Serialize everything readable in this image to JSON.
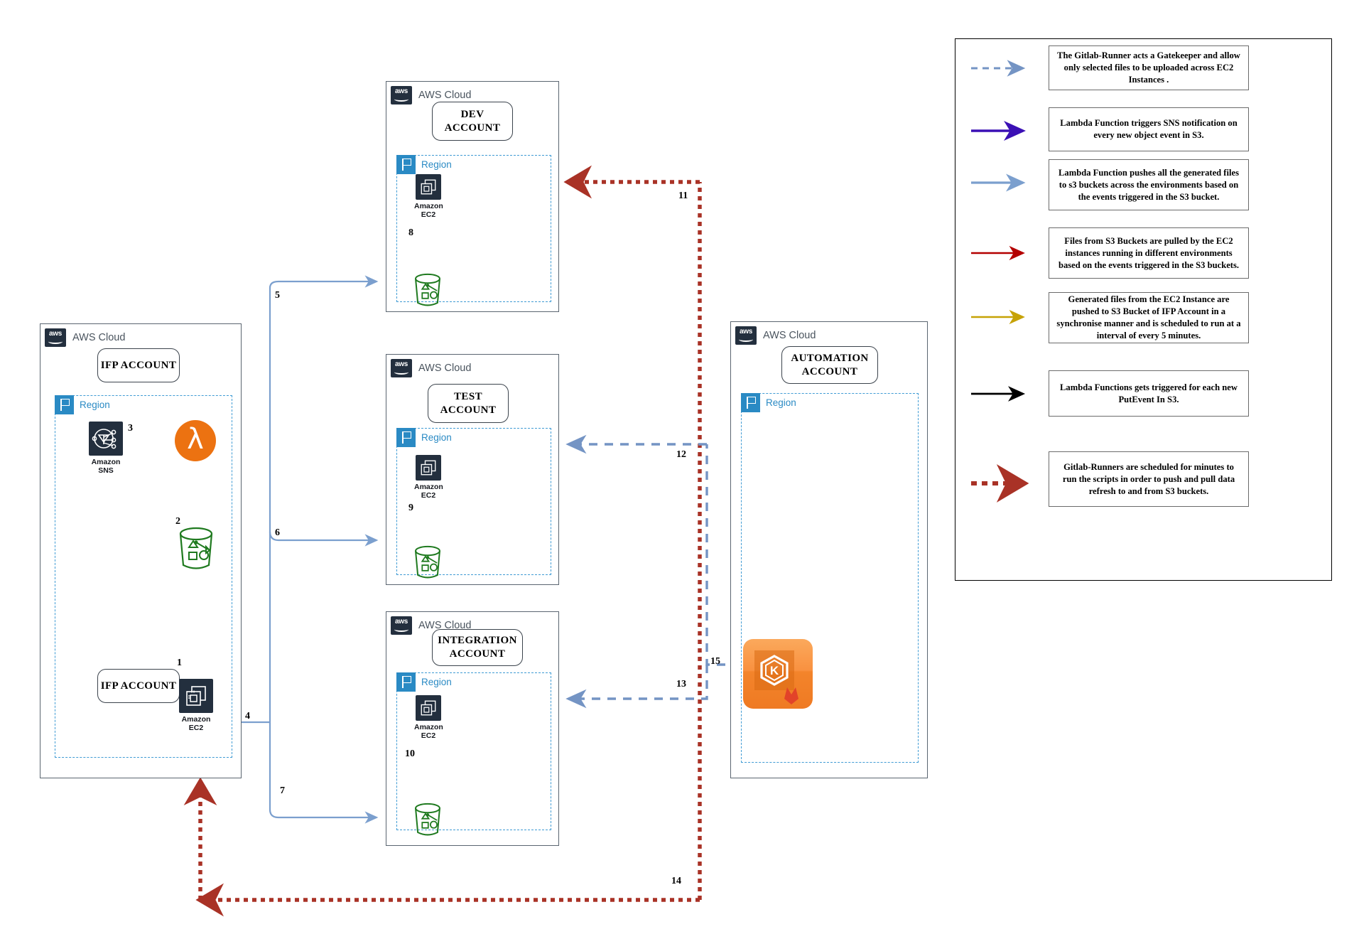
{
  "diagram": {
    "cloud_label": "AWS Cloud",
    "region_label": "Region"
  },
  "accounts": [
    {
      "id": "ifp",
      "title": "IFP ACCOUNT",
      "cloud_label": "AWS Cloud",
      "region_label": "Region",
      "resources": [
        {
          "name": "Amazon SNS",
          "line1": "Amazon",
          "line2": "SNS",
          "type": "sns"
        },
        {
          "name": "AWS Lambda",
          "type": "lambda"
        },
        {
          "name": "Amazon S3",
          "type": "s3"
        },
        {
          "name": "Amazon EC2",
          "line1": "Amazon",
          "line2": "EC2",
          "type": "ec2"
        }
      ]
    },
    {
      "id": "dev",
      "title": "DEV ACCOUNT",
      "title_line1": "DEV",
      "title_line2": "ACCOUNT",
      "cloud_label": "AWS Cloud",
      "region_label": "Region",
      "resources": [
        {
          "name": "Amazon EC2",
          "line1": "Amazon",
          "line2": "EC2",
          "type": "ec2"
        },
        {
          "name": "Amazon S3",
          "type": "s3"
        }
      ]
    },
    {
      "id": "test",
      "title": "TEST ACCOUNT",
      "title_line1": "TEST",
      "title_line2": "ACCOUNT",
      "cloud_label": "AWS Cloud",
      "region_label": "Region",
      "resources": [
        {
          "name": "Amazon EC2",
          "line1": "Amazon",
          "line2": "EC2",
          "type": "ec2"
        },
        {
          "name": "Amazon S3",
          "type": "s3"
        }
      ]
    },
    {
      "id": "integration",
      "title": "INTEGRATION ACCOUNT",
      "title_line1": "INTEGRATION",
      "title_line2": "ACCOUNT",
      "cloud_label": "AWS Cloud",
      "region_label": "Region",
      "resources": [
        {
          "name": "Amazon EC2",
          "line1": "Amazon",
          "line2": "EC2",
          "type": "ec2"
        },
        {
          "name": "Amazon S3",
          "type": "s3"
        }
      ]
    },
    {
      "id": "automation",
      "title": "AUTOMATION ACCOUNT",
      "title_line1": "AUTOMATION",
      "title_line2": "ACCOUNT",
      "cloud_label": "AWS Cloud",
      "region_label": "Region",
      "resources": [
        {
          "name": "GitLab Runner",
          "type": "gitlab"
        }
      ]
    }
  ],
  "step_numbers": {
    "n1": "1",
    "n2": "2",
    "n3": "3",
    "n4": "4",
    "n5": "5",
    "n6": "6",
    "n7": "7",
    "n8": "8",
    "n9": "9",
    "n10": "10",
    "n11": "11",
    "n12": "12",
    "n13": "13",
    "n14": "14",
    "n15": "15"
  },
  "legend": {
    "items": [
      {
        "style": "dashed",
        "color": "#7494c4",
        "text": "The Gitlab-Runner acts a Gatekeeper and allow only selected files to be uploaded across EC2 Instances ."
      },
      {
        "style": "solid",
        "color": "#3b10b5",
        "text": "Lambda Function  triggers  SNS notification on every new object event in S3."
      },
      {
        "style": "solid",
        "color": "#7b9fce",
        "text": "Lambda Function pushes all the generated files to s3 buckets across the environments based on the events triggered in the  S3 bucket."
      },
      {
        "style": "solid",
        "color": "#b40000",
        "text": "Files from S3 Buckets are pulled by the EC2 instances running in different environments based on the events triggered  in the S3 buckets."
      },
      {
        "style": "solid",
        "color": "#c6a206",
        "text": "Generated files from the EC2 Instance are pushed to S3 Bucket of IFP Account in a synchronise manner and is scheduled to run at a interval of every 5 minutes."
      },
      {
        "style": "solid",
        "color": "#000000",
        "text": "Lambda Functions gets triggered for each new PutEvent In S3."
      },
      {
        "style": "dotted",
        "color": "#a93226",
        "text": "Gitlab-Runners are scheduled for minutes to run the scripts in order to push and pull data refresh to and from S3 buckets."
      }
    ]
  }
}
